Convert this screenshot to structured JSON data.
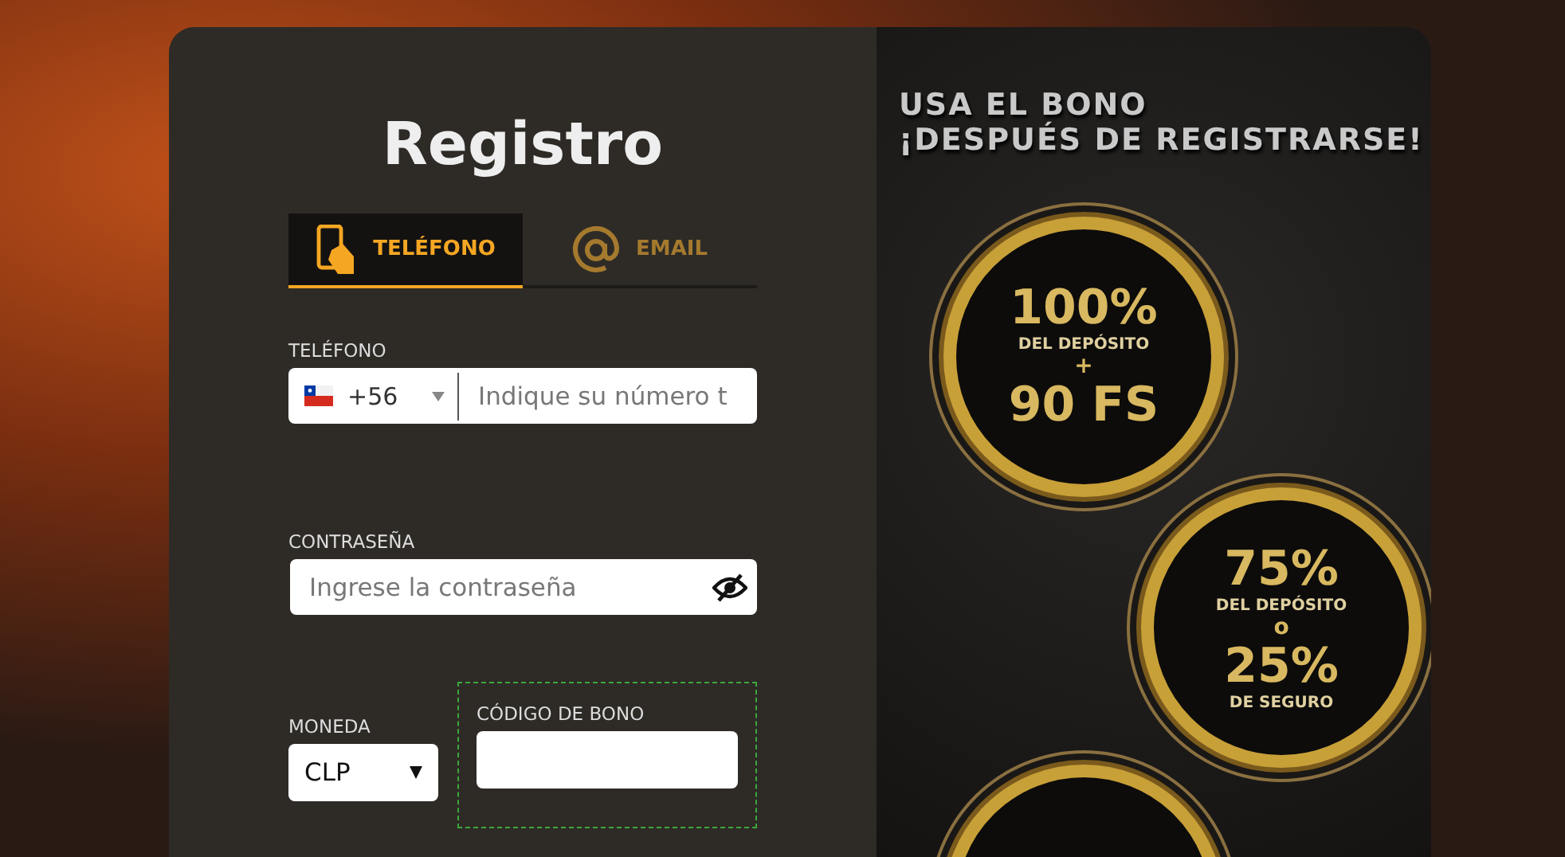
{
  "form": {
    "title": "Registro",
    "tabs": [
      {
        "label": "TELÉFONO",
        "kind": "phone",
        "selected": true
      },
      {
        "label": "EMAIL",
        "kind": "email",
        "selected": false
      }
    ],
    "phone": {
      "label": "TELÉFONO",
      "country_code": "+56",
      "placeholder": "Indique su número t"
    },
    "password": {
      "label": "CONTRASEÑA",
      "placeholder": "Ingrese la contraseña"
    },
    "currency": {
      "label": "MONEDA",
      "value": "CLP"
    },
    "bonus_code": {
      "label": "CÓDIGO DE BONO"
    }
  },
  "promo": {
    "heading": [
      "USA EL BONO",
      "¡DESPUÉS DE REGISTRARSE!"
    ],
    "badges": [
      {
        "lines": [
          {
            "kind": "big",
            "text": "100%"
          },
          {
            "kind": "small",
            "text": "DEL DEPÓSITO"
          },
          {
            "kind": "sep",
            "text": "+"
          },
          {
            "kind": "big",
            "text": "90 FS"
          }
        ]
      },
      {
        "lines": [
          {
            "kind": "big",
            "text": "75%"
          },
          {
            "kind": "small",
            "text": "DEL DEPÓSITO"
          },
          {
            "kind": "sep",
            "text": "o"
          },
          {
            "kind": "big",
            "text": "25%"
          },
          {
            "kind": "small",
            "text": "DE SEGURO"
          }
        ]
      }
    ]
  }
}
